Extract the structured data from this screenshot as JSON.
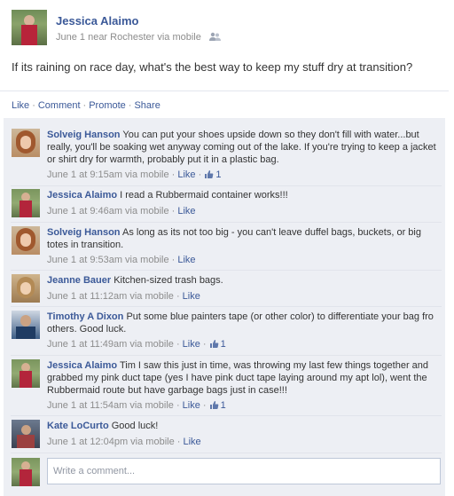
{
  "post": {
    "author": "Jessica Alaimo",
    "meta": "June 1 near Rochester via mobile",
    "text": "If its raining on race day, what's the best way to keep my stuff dry at transition?",
    "audience_icon": "friends-icon"
  },
  "actions": {
    "like": "Like",
    "comment": "Comment",
    "promote": "Promote",
    "share": "Share"
  },
  "comments": [
    {
      "name": "Solveig Hanson",
      "text": "You can put your shoes upside down so they don't fill with water...but really, you'll be soaking wet anyway coming out of the lake. If you're trying to keep a jacket or shirt dry for warmth, probably put it in a plastic bag.",
      "meta": "June 1 at 9:15am via mobile",
      "like": "Like",
      "likes": "1"
    },
    {
      "name": "Jessica Alaimo",
      "text": "I read a Rubbermaid container works!!!",
      "meta": "June 1 at 9:46am via mobile",
      "like": "Like"
    },
    {
      "name": "Solveig Hanson",
      "text": "As long as its not too big - you can't leave duffel bags, buckets, or big totes in transition.",
      "meta": "June 1 at 9:53am via mobile",
      "like": "Like"
    },
    {
      "name": "Jeanne Bauer",
      "text": "Kitchen-sized trash bags.",
      "meta": "June 1 at 11:12am via mobile",
      "like": "Like"
    },
    {
      "name": "Timothy A Dixon",
      "text": "Put some blue painters tape (or other color) to differentiate your bag fro others. Good luck.",
      "meta": "June 1 at 11:49am via mobile",
      "like": "Like",
      "likes": "1"
    },
    {
      "name": "Jessica Alaimo",
      "text": "Tim I saw this just in time, was throwing my last few things together and grabbed my pink duct tape (yes I have pink duct tape laying around my apt lol), went the Rubbermaid route but have garbage bags just in case!!!",
      "meta": "June 1 at 11:54am via mobile",
      "like": "Like",
      "likes": "1"
    },
    {
      "name": "Kate LoCurto",
      "text": "Good luck!",
      "meta": "June 1 at 12:04pm via mobile",
      "like": "Like"
    }
  ],
  "comment_input": {
    "placeholder": "Write a comment..."
  },
  "colors": {
    "link": "#3b5998",
    "meta": "#8c8c8c",
    "comment_bg": "#edeff4"
  }
}
